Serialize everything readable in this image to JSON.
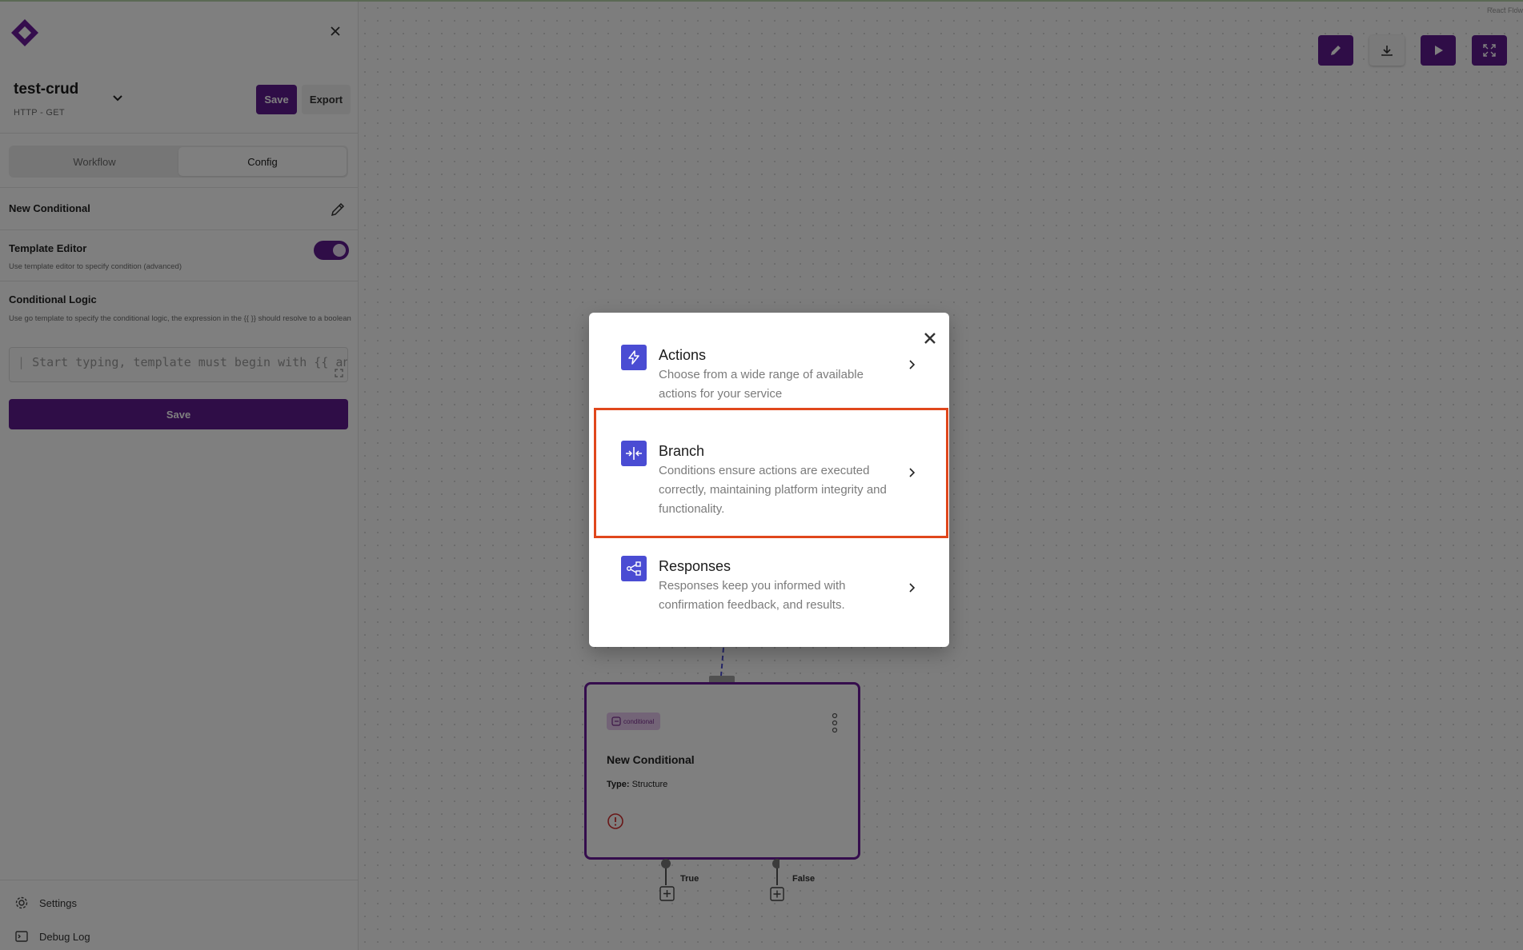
{
  "sidebar": {
    "close_icon": "close-icon",
    "service": {
      "name": "test-crud",
      "method": "HTTP - GET"
    },
    "save_label": "Save",
    "export_label": "Export",
    "tabs": [
      {
        "label": "Workflow",
        "active": false
      },
      {
        "label": "Config",
        "active": true
      }
    ],
    "node_name": "New Conditional",
    "template_editor": {
      "title": "Template Editor",
      "description": "Use template editor to specify condition (advanced)",
      "enabled": true
    },
    "conditional_logic": {
      "title": "Conditional Logic",
      "description": "Use go template to specify the conditional logic, the expression in the {{ }} should resolve to a boolean",
      "placeholder": "Start typing, template must begin with {{ an"
    },
    "save_button": "Save",
    "footer": {
      "settings": "Settings",
      "debug_log": "Debug Log"
    }
  },
  "canvas": {
    "attribution": "React Flow",
    "toolbar": [
      "edit-icon",
      "download-icon",
      "play-icon",
      "fullscreen-icon"
    ],
    "node": {
      "badge": "conditional",
      "title": "New Conditional",
      "type_label": "Type:",
      "type_value": "Structure",
      "edges": {
        "true_label": "True",
        "false_label": "False"
      }
    }
  },
  "modal": {
    "options": [
      {
        "title": "Actions",
        "description": "Choose from a wide range of available actions for your service",
        "icon": "lightning-icon"
      },
      {
        "title": "Branch",
        "description": "Conditions ensure actions are executed correctly, maintaining platform integrity and functionality.",
        "icon": "branch-icon",
        "highlighted": true
      },
      {
        "title": "Responses",
        "description": "Responses keep you informed with confirmation feedback, and results.",
        "icon": "flow-icon"
      }
    ]
  },
  "colors": {
    "brand": "#5f1a8f",
    "modal_icon": "#4a4cd3",
    "highlight": "#e0471c"
  }
}
